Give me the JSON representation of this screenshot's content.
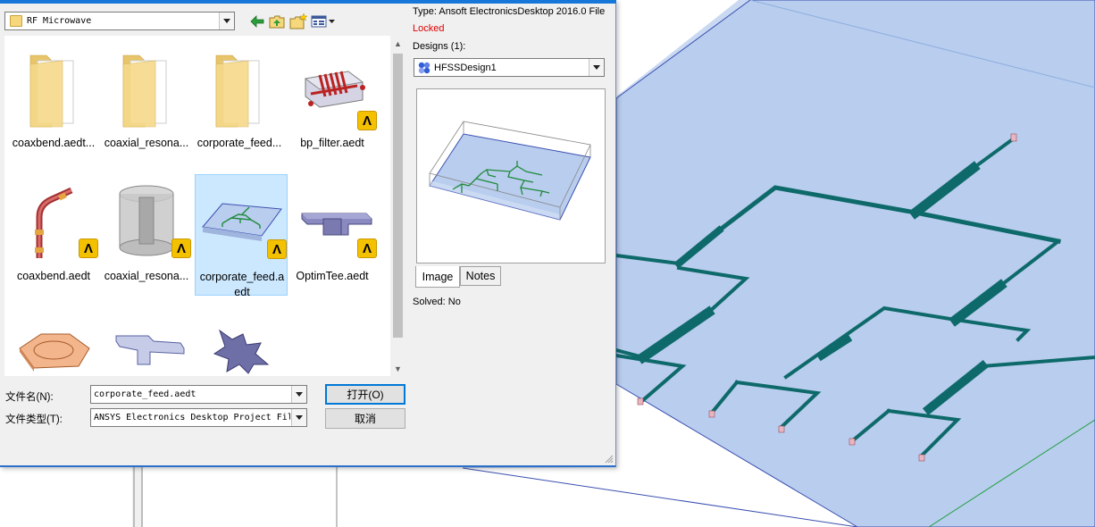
{
  "dialog": {
    "look_in": "RF Microwave",
    "toolbar_icons": [
      "back-arrow-icon",
      "up-folder-icon",
      "new-folder-icon",
      "view-menu-icon"
    ],
    "files": [
      {
        "label": "coaxbend.aedt...",
        "kind": "folder"
      },
      {
        "label": "coaxial_resona...",
        "kind": "folder"
      },
      {
        "label": "corporate_feed...",
        "kind": "folder"
      },
      {
        "label": "bp_filter.aedt",
        "kind": "project"
      },
      {
        "label": "coaxbend.aedt",
        "kind": "project"
      },
      {
        "label": "coaxial_resona...",
        "kind": "project"
      },
      {
        "label": "corporate_feed.aedt",
        "kind": "project",
        "selected": true
      },
      {
        "label": "OptimTee.aedt",
        "kind": "project"
      },
      {
        "label": "",
        "kind": "project"
      },
      {
        "label": "",
        "kind": "project"
      },
      {
        "label": "",
        "kind": "project"
      }
    ],
    "badge_glyph": "Λ",
    "filename_label": "文件名(N):",
    "filename_value": "corporate_feed.aedt",
    "filetype_label": "文件类型(T):",
    "filetype_value": "ANSYS Electronics Desktop Project Fil",
    "open_button": "打开(O)",
    "cancel_button": "取消",
    "scroll_up": "▲",
    "scroll_down": "▼"
  },
  "info": {
    "type": "Type: Ansoft ElectronicsDesktop 2016.0 File",
    "locked": "Locked",
    "designs_label": "Designs (1):",
    "design_selected": "HFSSDesign1",
    "tabs": [
      {
        "label": "Image"
      },
      {
        "label": "Notes"
      }
    ],
    "solved": "Solved:  No"
  },
  "colors": {
    "accent": "#1677d8",
    "locked": "#e00000",
    "substrate": "#b9cdee",
    "trace": "#0e6a6a",
    "badge": "#f4c100",
    "selection": "#cce8ff"
  }
}
